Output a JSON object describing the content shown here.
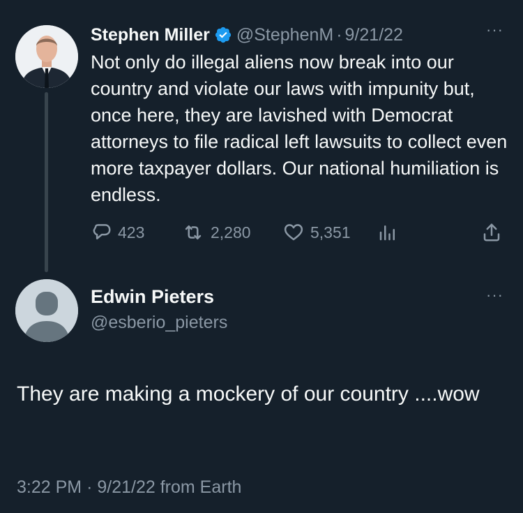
{
  "parent_tweet": {
    "display_name": "Stephen Miller",
    "handle": "@StephenM",
    "separator": "·",
    "date": "9/21/22",
    "text": "Not only do illegal aliens now break into our country and violate our laws with impunity but, once here, they are lavished with Democrat attorneys to file radical left lawsuits to collect even more taxpayer dollars. Our national humiliation is endless.",
    "replies": "423",
    "retweets": "2,280",
    "likes": "5,351",
    "more": "···"
  },
  "reply_tweet": {
    "display_name": "Edwin Pieters",
    "handle": "@esberio_pieters",
    "text": "They are making a mockery of our country ....wow",
    "time": "3:22 PM",
    "separator": "·",
    "date": "9/21/22",
    "source": "from Earth",
    "more": "···"
  },
  "colors": {
    "background": "#15202b",
    "text": "#f7f9f9",
    "muted": "#8b98a5",
    "verified": "#1d9bf0",
    "thread_line": "#38444d"
  },
  "icons": {
    "verified": "verified-badge-icon",
    "reply": "reply-icon",
    "retweet": "retweet-icon",
    "like": "heart-icon",
    "views": "views-bar-chart-icon",
    "share": "share-icon"
  }
}
